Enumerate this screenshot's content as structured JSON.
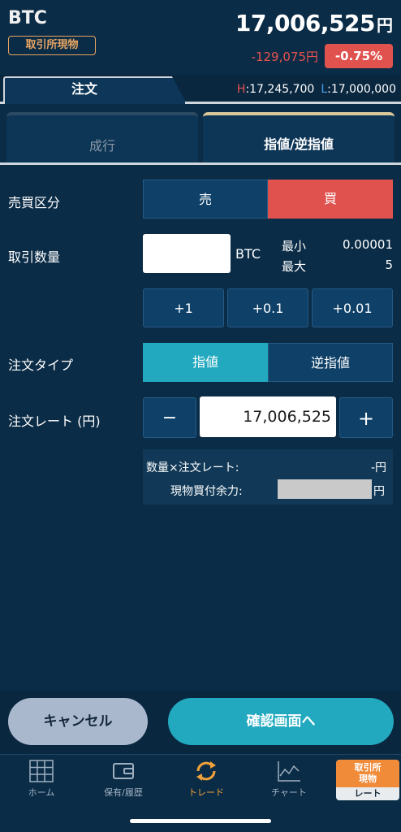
{
  "header": {
    "symbol": "BTC",
    "market_badge": "取引所現物",
    "price": "17,006,525",
    "price_unit": "円",
    "change": "-129,075円",
    "change_pct": "-0.75%"
  },
  "tabs": {
    "order": "注文",
    "high_label": "H",
    "high_value": ":17,245,700",
    "low_label": "L",
    "low_value": ":17,000,000"
  },
  "order_types": {
    "market": "成行",
    "limit_stop": "指値/逆指値"
  },
  "form": {
    "side_label": "売買区分",
    "sell": "売",
    "buy": "買",
    "quantity_label": "取引数量",
    "quantity_unit": "BTC",
    "min_label": "最小",
    "min_value": "0.00001",
    "max_label": "最大",
    "max_value": "5",
    "inc_1": "+1",
    "inc_01": "+0.1",
    "inc_001": "+0.01",
    "type_label": "注文タイプ",
    "type_limit": "指値",
    "type_stop": "逆指値",
    "rate_label": "注文レート (円)",
    "minus": "−",
    "rate_value": "17,006,525",
    "plus": "+",
    "summary_total_label": "数量×注文レート:",
    "summary_total_value": "-円",
    "summary_balance_label": "現物買付余力:",
    "summary_balance_unit": "円"
  },
  "actions": {
    "cancel": "キャンセル",
    "confirm": "確認画面へ"
  },
  "nav": {
    "home": "ホーム",
    "holdings": "保有/履歴",
    "trade": "トレード",
    "chart": "チャート",
    "rate_badge_top": "取引所\n現物",
    "rate_badge_bottom": "レート"
  },
  "colors": {
    "background": "#0b2c47",
    "buy_red": "#e0524e",
    "teal": "#22a9bf",
    "badge_orange": "#e9a562",
    "negative": "#e9524e",
    "low_blue": "#4aa0e6"
  }
}
